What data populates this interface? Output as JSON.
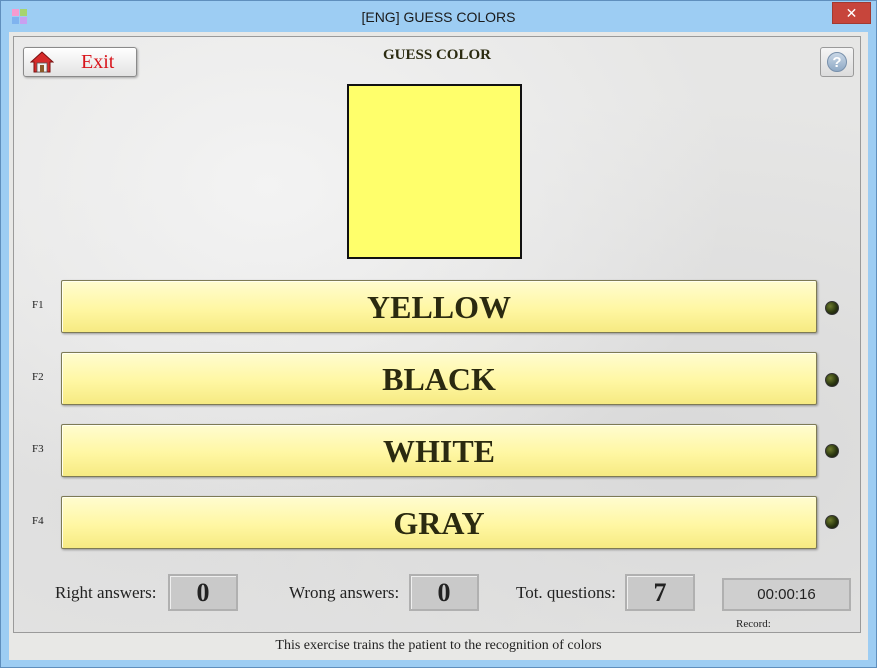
{
  "window": {
    "title": "[ENG] GUESS COLORS",
    "close_glyph": "✕",
    "app_icon": "colored-squares-icon",
    "app_icon_colors": [
      "#f59bd0",
      "#a7d46f",
      "#7fb3ef",
      "#c9a0f0"
    ]
  },
  "toolbar": {
    "exit_label": "Exit",
    "exit_icon": "home-icon",
    "help_glyph": "?",
    "help_icon": "question-circle-icon"
  },
  "page_title": "GUESS COLOR",
  "swatch": {
    "color": "#ffff6b"
  },
  "answers": [
    {
      "key": "F1",
      "label": "YELLOW",
      "indicator": "off"
    },
    {
      "key": "F2",
      "label": "BLACK",
      "indicator": "off"
    },
    {
      "key": "F3",
      "label": "WHITE",
      "indicator": "off"
    },
    {
      "key": "F4",
      "label": "GRAY",
      "indicator": "off"
    }
  ],
  "stats": {
    "right_label": "Right answers:",
    "right_value": "0",
    "wrong_label": "Wrong answers:",
    "wrong_value": "0",
    "total_label": "Tot. questions:",
    "total_value": "7",
    "time_value": "00:00:16",
    "record_label": "Record:"
  },
  "footer_text": "This exercise trains the patient to the recognition of colors"
}
